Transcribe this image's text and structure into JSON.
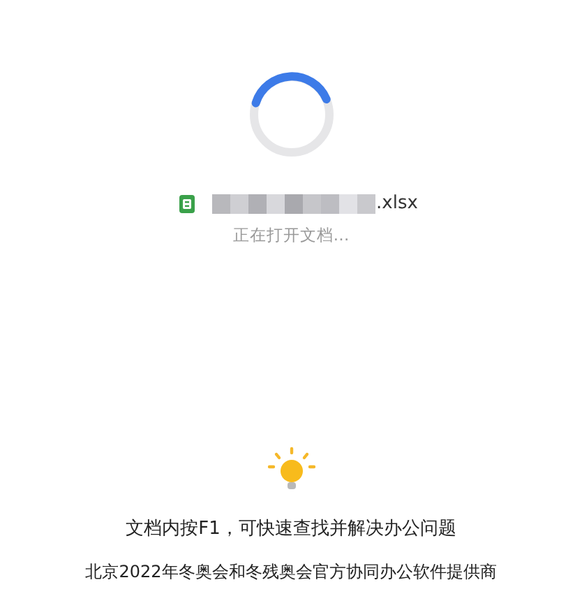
{
  "file": {
    "extension": ".xlsx",
    "status": "正在打开文档…"
  },
  "tip": {
    "text": "文档内按F1，可快速查找并解决办公问题"
  },
  "footer": {
    "text": "北京2022年冬奥会和冬残奥会官方协同办公软件提供商"
  }
}
